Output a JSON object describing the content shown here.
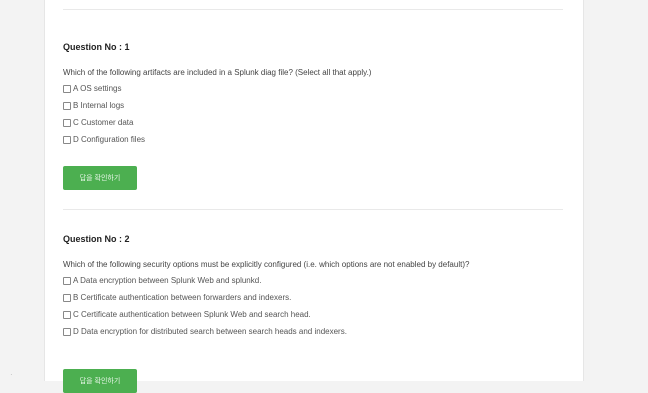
{
  "questions": [
    {
      "title": "Question No : 1",
      "text": "Which of the following artifacts are included in a Splunk diag file? (Select all that apply.)",
      "options": [
        "A OS settings",
        "B Internal logs",
        "C Customer data",
        "D Configuration files"
      ],
      "button_label": "답을 확인하기"
    },
    {
      "title": "Question No : 2",
      "text": "Which of the following security options must be explicitly configured (i.e. which options are not enabled by default)?",
      "options": [
        "A Data encryption between Splunk Web and splunkd.",
        "B Certificate authentication between forwarders and indexers.",
        "C Certificate authentication between Splunk Web and search head.",
        "D Data encryption for distributed search between search heads and indexers."
      ],
      "button_label": "답을 확인하기"
    }
  ],
  "colors": {
    "button": "#4caf50",
    "page_bg": "#ffffff",
    "outer_bg": "#f3f3f3"
  }
}
